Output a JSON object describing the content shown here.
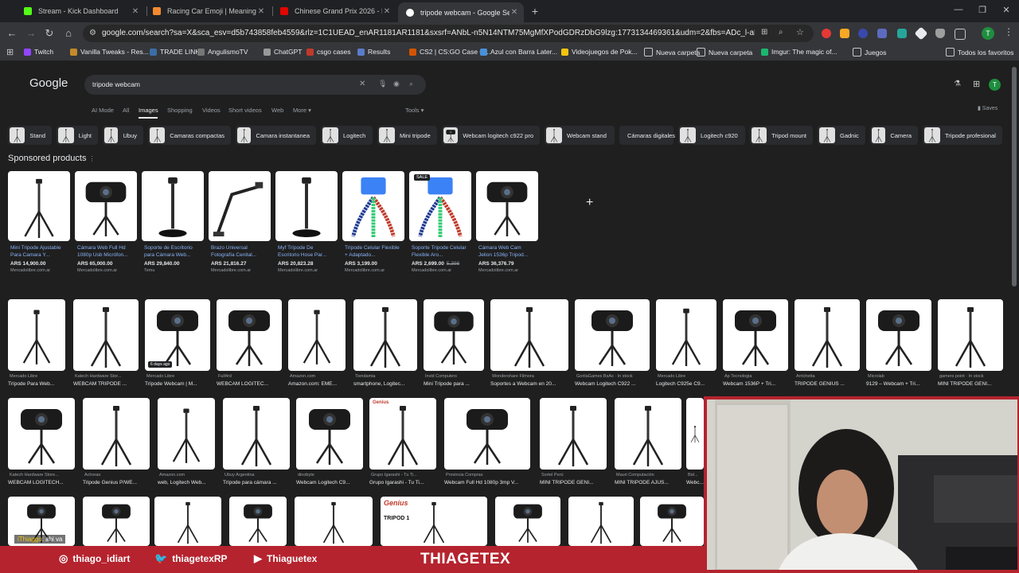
{
  "tabs": [
    {
      "title": "Stream - Kick Dashboard",
      "color": "#53fc18"
    },
    {
      "title": "Racing Car Emoji | Meaning",
      "color": "#f28b30"
    },
    {
      "title": "Chinese Grand Prix 2026 - F1 R",
      "color": "#e10600"
    },
    {
      "title": "tripode webcam - Google Sear",
      "color": "#8ab4f8"
    }
  ],
  "window": {
    "new_tab": "+",
    "minimize": "—",
    "restore": "❐",
    "close": "✕"
  },
  "toolbar": {
    "back": "←",
    "forward": "→",
    "reload": "↻",
    "home": "⌂",
    "url": "google.com/search?sa=X&sca_esv=d5b743858feb4559&rlz=1C1UEAD_enAR1181AR1181&sxsrf=ANbL-n5N14NTM75MgMfXPodGDRzDbG9lzg:1773134469361&udm=2&fbs=ADc_l-aN0CWEZBOHj...",
    "profile": "T"
  },
  "bookmarks": [
    {
      "label": "Twitch",
      "color": "#9146ff"
    },
    {
      "label": "Vanilla Tweaks - Res...",
      "color": "#c48a2b"
    },
    {
      "label": "TRADE LINK",
      "color": "#3a6ea5"
    },
    {
      "label": "AngulismoTV",
      "color": "#777"
    },
    {
      "label": "ChatGPT",
      "color": "#999"
    },
    {
      "label": "csgo cases",
      "color": "#c0392b"
    },
    {
      "label": "Results",
      "color": "#5b7cc9"
    },
    {
      "label": "CS2 | CS:GO Case O...",
      "color": "#d35400"
    },
    {
      "label": "Azul con Barra Later...",
      "color": "#4a90d9"
    },
    {
      "label": "Videojuegos de Pok...",
      "color": "#f1c40f"
    },
    {
      "label": "Nueva carpeta",
      "color": "folder"
    },
    {
      "label": "Nueva carpeta",
      "color": "folder"
    },
    {
      "label": "Imgur: The magic of...",
      "color": "#1bb76e"
    },
    {
      "label": "Juegos",
      "color": "folder"
    }
  ],
  "bookmarks_all": "Todos los favoritos",
  "google": {
    "logo": "Google",
    "query": "tripode webcam",
    "saves": "Saves",
    "avatar": "T",
    "nav": [
      "AI Mode",
      "All",
      "Images",
      "Shopping",
      "Videos",
      "Short videos",
      "Web",
      "More ▾",
      "Tools ▾"
    ],
    "chips": [
      "Stand",
      "Light",
      "Ubuy",
      "Camaras compactas",
      "Camara instantanea",
      "Logitech",
      "Mini tripode",
      "Webcam logitech c922 pro",
      "Webcam stand",
      "Cámaras digitales",
      "Logitech c920",
      "Tripod mount",
      "Gadnic",
      "Camera",
      "Tripode profesional"
    ]
  },
  "sponsored": {
    "title": "Sponsored products",
    "info": "⋮",
    "products": [
      {
        "name": "Mini Tripode Ajustable Para Camara Y...",
        "price": "ARS 14,900.00",
        "store": "Mercadolibre.com.ar",
        "kind": "tripod"
      },
      {
        "name": "Cámara Web Full Hd 1080p Usb Micrófon...",
        "price": "ARS 65,000.00",
        "store": "Mercadolibre.com.ar",
        "kind": "webcam"
      },
      {
        "name": "Soporte de Escritorio para Cámara Web...",
        "price": "ARS 29,840.00",
        "store": "Temu",
        "kind": "stand"
      },
      {
        "name": "Brazo Universal Fotografía Cenital...",
        "price": "ARS 21,816.27",
        "store": "Mercadolibre.com.ar",
        "kind": "arm"
      },
      {
        "name": "Myf Trípode De Escritorio Hose Par...",
        "price": "ARS 20,823.28",
        "store": "Mercadolibre.com.ar",
        "kind": "stand"
      },
      {
        "name": "Trípode Celular Flexible + Adaptado...",
        "price": "ARS 3,199.00",
        "store": "Mercadolibre.com.ar",
        "kind": "flex"
      },
      {
        "name": "Soporte Tripode Celular Flexible Aro...",
        "price": "ARS 2,699.00",
        "old": "5,398",
        "store": "Mercadolibre.com.ar",
        "kind": "flex",
        "badge": "SALE"
      },
      {
        "name": "Cámara Web Cam Jelion 1536p Tripod...",
        "price": "ARS 36,376.79",
        "store": "Mercadolibre.com.ar",
        "kind": "webcam"
      }
    ]
  },
  "row1": [
    {
      "src": "Mercado Libre",
      "cap": "Trípode Para Web..."
    },
    {
      "src": "Katech Hardware Stor...",
      "cap": "WEBCAM TRIPODE ..."
    },
    {
      "src": "Mercado Libre",
      "cap": "Trípode Webcam | M..."
    },
    {
      "src": "Full4rd",
      "cap": "WEBCAM LOGITEC..."
    },
    {
      "src": "Amazon.com",
      "cap": "Amazon.com: EME..."
    },
    {
      "src": "Tiendamia",
      "cap": "smartphone, Logitec..."
    },
    {
      "src": "Invid Computers",
      "cap": "Mini Trípode para ..."
    },
    {
      "src": "Wondershare Filmora",
      "cap": "Soportes a Webcam en 20..."
    },
    {
      "src": "GorilaGames BsAs · In stock",
      "cap": "Webcam Logitech C922 ..."
    },
    {
      "src": "Mercado Libre",
      "cap": "Logitech C925e C9..."
    },
    {
      "src": "Ap Tecnologia",
      "cap": "Webcam 1536P + Tri..."
    },
    {
      "src": "Arrichetta",
      "cap": "TRIPODE GENIUS ..."
    },
    {
      "src": "Microlab",
      "cap": "9129 – Webcam + Tri..."
    },
    {
      "src": "gamers point · In stock",
      "cap": "MINI TRIPODE GENI..."
    }
  ],
  "row1_badge": "6 days ago",
  "row2": [
    {
      "src": "Katech Hardware Store...",
      "cap": "WEBCAM LOGITECH..."
    },
    {
      "src": "Achorao",
      "cap": "Tripode Genius P/WE..."
    },
    {
      "src": "Amazon.com",
      "cap": "web, Logitech Web..."
    },
    {
      "src": "Ubuy Argentina",
      "cap": "Trípode para cámara ..."
    },
    {
      "src": "dinobyte",
      "cap": "Webcam Logitech C9..."
    },
    {
      "src": "Grupo Igarashi - Tu Ti...",
      "cap": "Grupo Igarashi - Tu Ti..."
    },
    {
      "src": "Provincia Compras",
      "cap": "Webcam Full Hd 1080p 3mp V..."
    },
    {
      "src": "Sortel Perú",
      "cap": "MINI TRIPODE GENI..."
    },
    {
      "src": "Mauri Computación",
      "cap": "MINI TRIPODE AJUS..."
    },
    {
      "src": "Bid...",
      "cap": "Webc..."
    }
  ],
  "row3_labels": {
    "genius": "Genius",
    "tripod": "TRIPOD 1"
  },
  "overlay": {
    "chat_user": "iThiaggo",
    "chat_msg": ": ahi va",
    "instagram": "thiago_idiart",
    "twitter": "thiagetexRP",
    "youtube": "Thiaguetex",
    "brand": "THIAGETEX",
    "frame_color": "#b5232e"
  }
}
